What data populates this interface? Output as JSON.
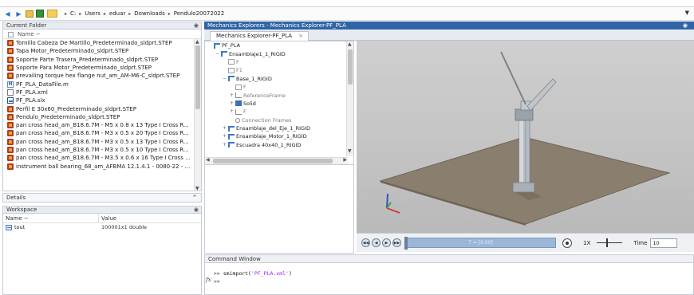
{
  "address_bar": {
    "path": [
      "C:",
      "Users",
      "eduar",
      "Downloads",
      "Pendulo20072022"
    ],
    "dropdown_icon": "chevron-down"
  },
  "current_folder": {
    "title": "Current Folder",
    "column_name": "Name",
    "sort_indicator": "−",
    "files": [
      {
        "name": "Tornillo Cabeza De Martillo_Predeterminado_sldprt.STEP",
        "icon": "step"
      },
      {
        "name": "Tapa Motor_Predeterminado_sldprt.STEP",
        "icon": "step"
      },
      {
        "name": "Soporte Parte Trasera_Predeterminado_sldprt.STEP",
        "icon": "step"
      },
      {
        "name": "Soporte Para Motor_Predeterminado_sldprt.STEP",
        "icon": "step"
      },
      {
        "name": "prevailing torque hex flange nut_am_AM-M6-C_sldprt.STEP",
        "icon": "step"
      },
      {
        "name": "PF_PLA_DataFile.m",
        "icon": "m"
      },
      {
        "name": "PF_PLA.xml",
        "icon": "xml"
      },
      {
        "name": "PF_PLA.slx",
        "icon": "slx"
      },
      {
        "name": "Perfil E 30x60_Predeterminado_sldprt.STEP",
        "icon": "step"
      },
      {
        "name": "Pendulo_Predeterminado_sldprt.STEP",
        "icon": "step"
      },
      {
        "name": "pan cross head_am_B18.6.7M - M5 x 0.8 x 13 Type I Cross R...",
        "icon": "step"
      },
      {
        "name": "pan cross head_am_B18.6.7M - M3 x 0.5 x 20 Type I Cross R...",
        "icon": "step"
      },
      {
        "name": "pan cross head_am_B18.6.7M - M3 x 0.5 x 13 Type I Cross R...",
        "icon": "step"
      },
      {
        "name": "pan cross head_am_B18.6.7M - M3 x 0.5 x 10 Type I Cross R...",
        "icon": "step"
      },
      {
        "name": "pan cross head_am_B18.6.7M - M3.5 x 0.6 x 16 Type I Cross ...",
        "icon": "step"
      },
      {
        "name": "instrument ball bearing_68_am_AFBMA 12.1.4.1 - 0080-22 - ...",
        "icon": "step"
      }
    ]
  },
  "details": {
    "label": "Details",
    "chevron": "^"
  },
  "workspace": {
    "title": "Workspace",
    "columns": [
      "Name −",
      "Value"
    ],
    "rows": [
      {
        "name": "tout",
        "value": "100001x1 double"
      }
    ]
  },
  "mechanics_explorer": {
    "window_title": "Mechanics Explorers - Mechanics Explorer-PF_PLA",
    "tab_label": "Mechanics Explorer-PF_PLA",
    "tab_close": "×",
    "tree": [
      {
        "label": "PF_PLA",
        "indent": 0,
        "expander": "",
        "icon": "rigid",
        "grey": false
      },
      {
        "label": "Ensamblaje1_1_RIGID",
        "indent": 1,
        "expander": "−",
        "icon": "rigid",
        "grey": false
      },
      {
        "label": "F",
        "indent": 2,
        "expander": "",
        "icon": "frame",
        "grey": true
      },
      {
        "label": "F1",
        "indent": 2,
        "expander": "",
        "icon": "frame",
        "grey": true
      },
      {
        "label": "Base_1_RIGID",
        "indent": 2,
        "expander": "−",
        "icon": "rigid",
        "grey": false
      },
      {
        "label": "F",
        "indent": 3,
        "expander": "",
        "icon": "frame",
        "grey": true
      },
      {
        "label": "ReferenceFrame",
        "indent": 3,
        "expander": "+",
        "icon": "ref",
        "grey": true
      },
      {
        "label": "Solid",
        "indent": 3,
        "expander": "+",
        "icon": "solid",
        "grey": false
      },
      {
        "label": "F",
        "indent": 3,
        "expander": "+",
        "icon": "ref",
        "grey": true
      },
      {
        "label": "Connection Frames",
        "indent": 3,
        "expander": "",
        "icon": "conn",
        "grey": true
      },
      {
        "label": "Ensamblaje_del_Eje_1_RIGID",
        "indent": 2,
        "expander": "+",
        "icon": "rigid",
        "grey": false
      },
      {
        "label": "Ensamblaje_Motor_1_RIGID",
        "indent": 2,
        "expander": "+",
        "icon": "rigid",
        "grey": false
      },
      {
        "label": "Escuadra 40x40_1_RIGID",
        "indent": 2,
        "expander": "+",
        "icon": "rigid",
        "grey": false
      }
    ],
    "playback": {
      "time_text": "T = [0.00]",
      "speed": "1X",
      "time_label": "Time",
      "time_value": "10"
    }
  },
  "command_window": {
    "title": "Command Window",
    "lines": [
      {
        "prompt": ">>",
        "cmd": "smimport(",
        "str": "'PF_PLA.xml'",
        "end": ")"
      },
      {
        "prompt": ">>",
        "cmd": "",
        "str": "",
        "end": ""
      }
    ],
    "fx_label": "fx"
  },
  "colors": {
    "title_bar": "#2f65a6",
    "viewport_bg": "#c6c6c6",
    "plate": "#8a7f6f",
    "model": "#b7bdc4",
    "axis_x": "#d23a3a",
    "axis_y": "#3aa53a",
    "axis_z": "#3a4fc8"
  }
}
